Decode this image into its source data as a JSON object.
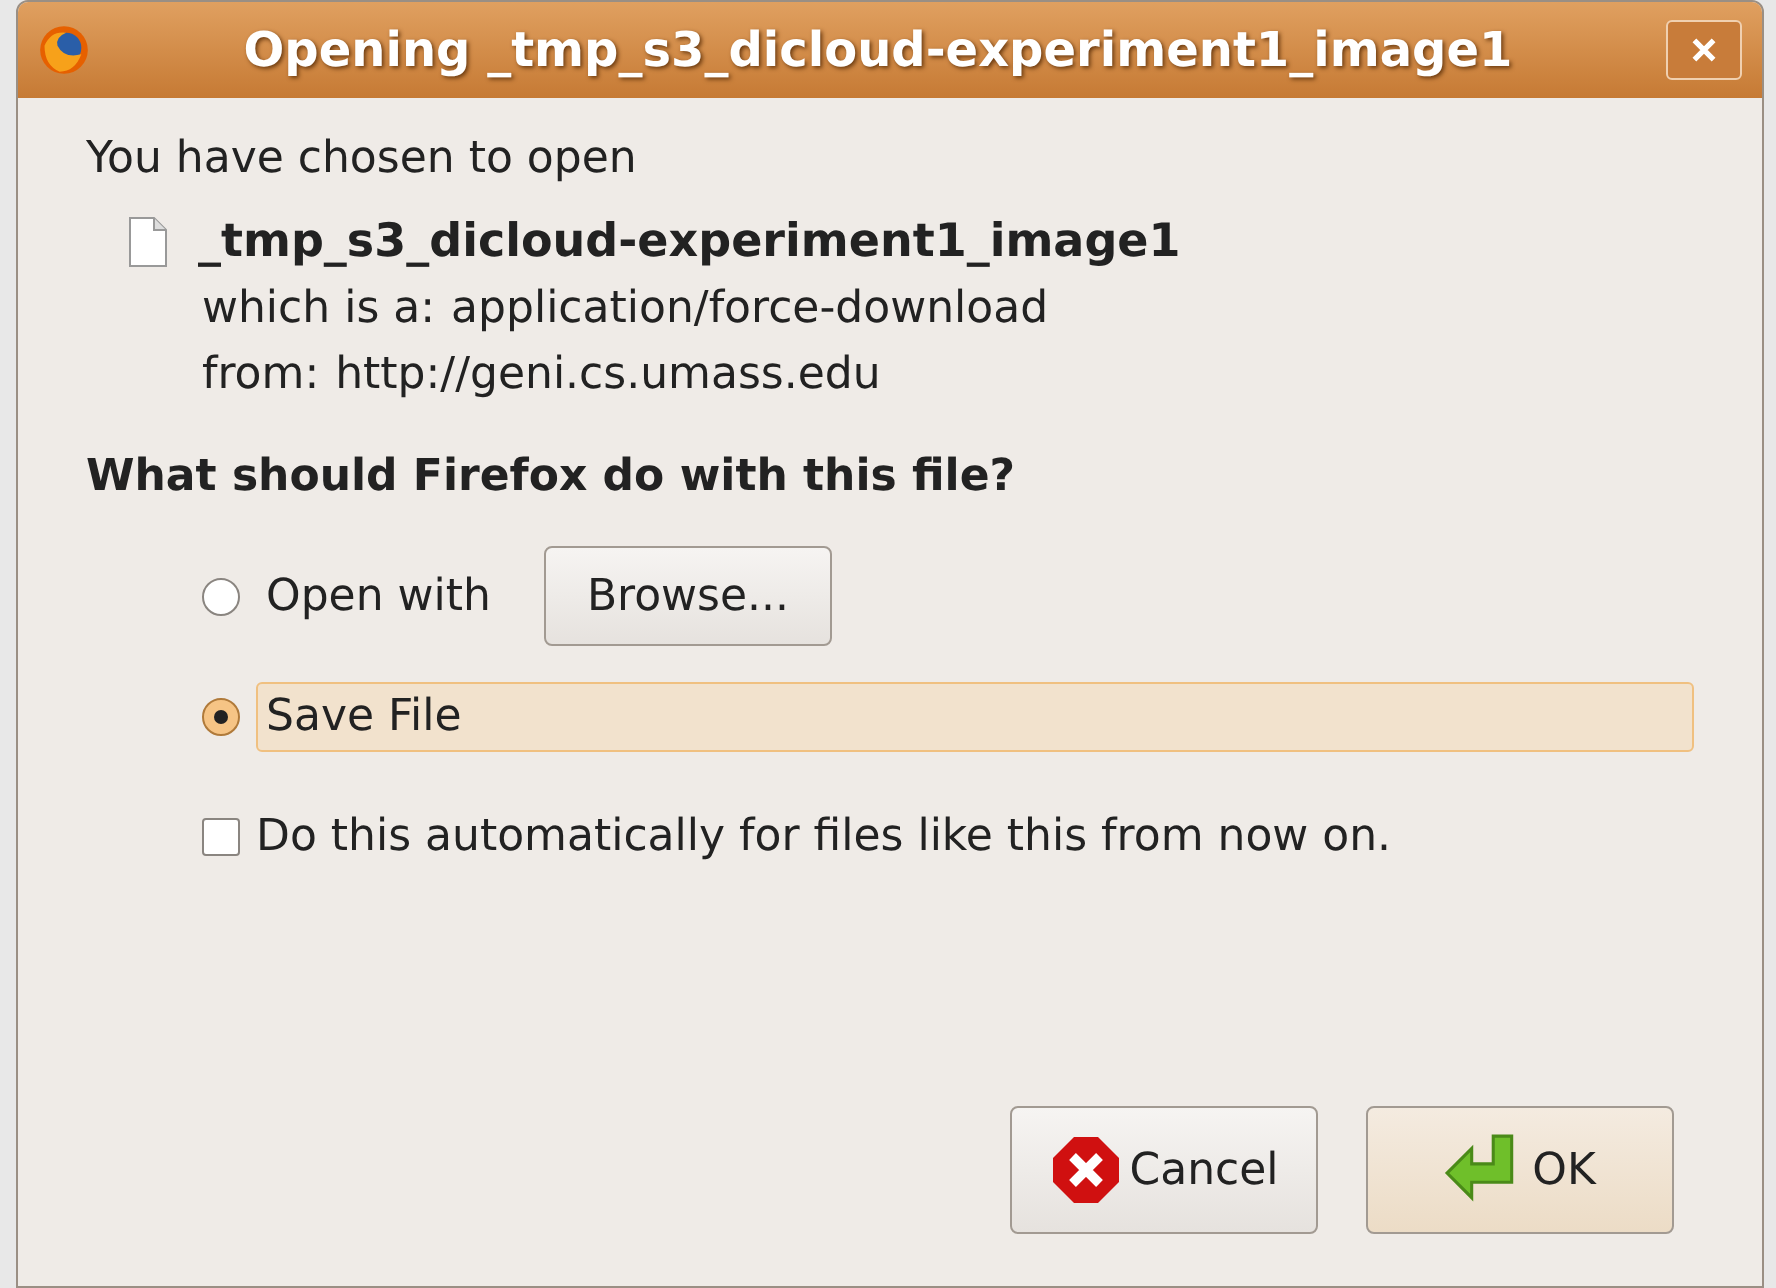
{
  "window": {
    "title": "Opening _tmp_s3_dicloud-experiment1_image1"
  },
  "intro": "You have chosen to open",
  "file": {
    "name": "_tmp_s3_dicloud-experiment1_image1",
    "type_label": "which is a:",
    "type": "application/force-download",
    "from_label": "from:",
    "from": "http://geni.cs.umass.edu"
  },
  "question": "What should Firefox do with this file?",
  "options": [
    {
      "label": "Open with",
      "selected": false,
      "button": "Browse..."
    },
    {
      "label": "Save File",
      "selected": true
    }
  ],
  "auto": {
    "label": "Do this automatically for files like this from now on.",
    "checked": false
  },
  "buttons": [
    {
      "kind": "cancel",
      "label": "Cancel"
    },
    {
      "kind": "ok",
      "label": "OK"
    }
  ]
}
